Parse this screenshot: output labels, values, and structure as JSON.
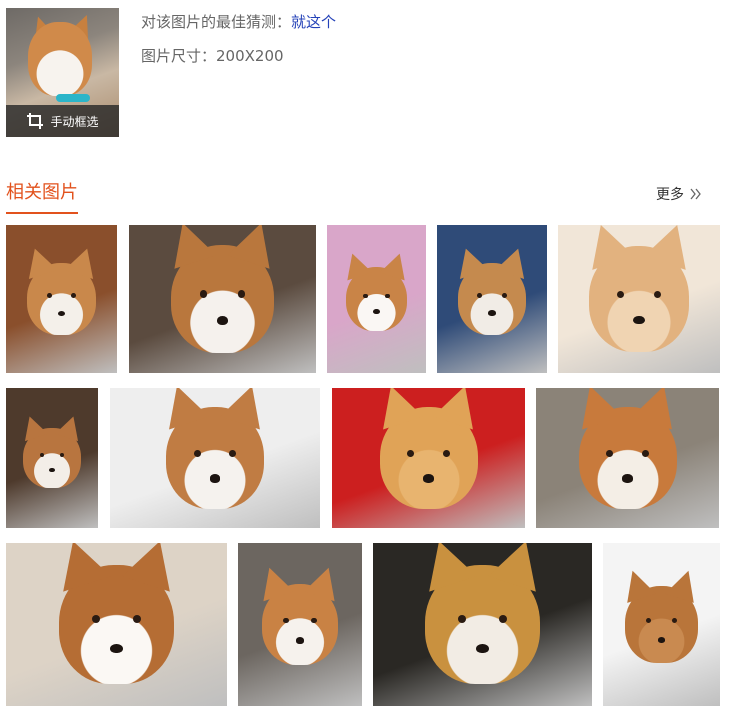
{
  "preview": {
    "crop_label": "手动框选",
    "crop_icon": "crop-icon"
  },
  "info": {
    "guess_label": "对该图片的最佳猜测：",
    "guess_value": "就这个",
    "size_label": "图片尺寸：",
    "size_value": "200X200"
  },
  "related": {
    "title": "相关图片",
    "more_label": "更多",
    "more_icon": "double-chevron-right-icon",
    "accent_color": "#e2521d"
  },
  "images": [
    {
      "name": "corgi-puppy-lying",
      "bg": "#8a4f2c",
      "fur": "#c9884b",
      "face": "#f4f0ea"
    },
    {
      "name": "chihuahua-puppies-in-box",
      "bg": "#5b4b3f",
      "fur": "#b9773d",
      "face": "#f5f1ed"
    },
    {
      "name": "chihuahua-pink-plaid",
      "bg": "#d9a6c9",
      "fur": "#c98447",
      "face": "#faf7f4"
    },
    {
      "name": "chihuahua-on-blue-couch",
      "bg": "#2f4b78",
      "fur": "#c58a4e",
      "face": "#f1ece6"
    },
    {
      "name": "tan-chihuahua-closeup",
      "bg": "#f1e6d8",
      "fur": "#e2b27f",
      "face": "#f0d4b2"
    },
    {
      "name": "papillon-on-leopard-blanket",
      "bg": "#4e3a2c",
      "fur": "#b8753f",
      "face": "#f3eee8"
    },
    {
      "name": "papillon-with-yellow-flowers",
      "bg": "#eeeeee",
      "fur": "#c07c43",
      "face": "#f5f2ee"
    },
    {
      "name": "pug-mix-red-background",
      "bg": "#cc1f1f",
      "fur": "#e0a357",
      "face": "#e8b46f"
    },
    {
      "name": "corgi-outdoor-closeup",
      "bg": "#8b8378",
      "fur": "#c87a3c",
      "face": "#f4eee6"
    },
    {
      "name": "puppy-on-floor",
      "bg": "#ddd3c6",
      "fur": "#b56d34",
      "face": "#fbf8f4"
    },
    {
      "name": "corgi-puppy-sitting",
      "bg": "#6c6660",
      "fur": "#c98244",
      "face": "#f6f2ed"
    },
    {
      "name": "dog-on-blue-chair",
      "bg": "#2a2824",
      "fur": "#c9913f",
      "face": "#f2ece4"
    },
    {
      "name": "tan-mixed-breed-dog",
      "bg": "#f4f4f4",
      "fur": "#b9753a",
      "face": "#c98a50"
    }
  ]
}
